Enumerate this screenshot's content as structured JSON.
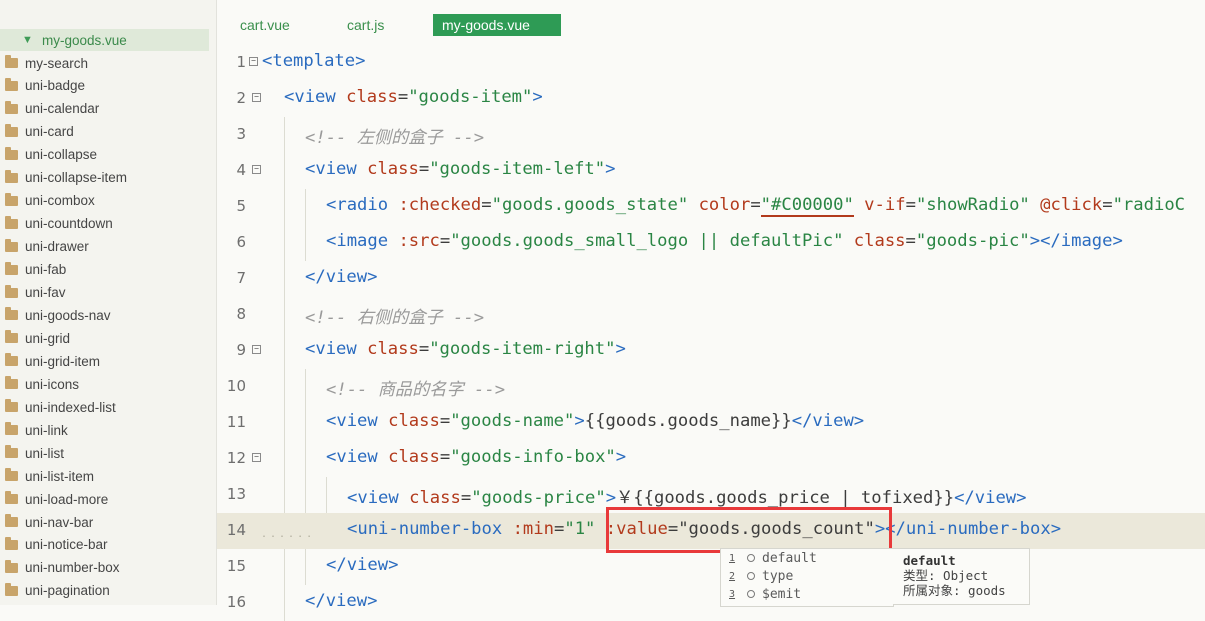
{
  "sidebar": {
    "root": "my-goods.vue",
    "items": [
      "my-search",
      "uni-badge",
      "uni-calendar",
      "uni-card",
      "uni-collapse",
      "uni-collapse-item",
      "uni-combox",
      "uni-countdown",
      "uni-drawer",
      "uni-fab",
      "uni-fav",
      "uni-goods-nav",
      "uni-grid",
      "uni-grid-item",
      "uni-icons",
      "uni-indexed-list",
      "uni-link",
      "uni-list",
      "uni-list-item",
      "uni-load-more",
      "uni-nav-bar",
      "uni-notice-bar",
      "uni-number-box",
      "uni-pagination"
    ]
  },
  "tabs": [
    "cart.vue",
    "cart.js",
    "my-goods.vue"
  ],
  "active_tab": 2,
  "editor": {
    "line_numbers": [
      "1",
      "2",
      "3",
      "4",
      "5",
      "6",
      "7",
      "8",
      "9",
      "10",
      "11",
      "12",
      "13",
      "14",
      "15",
      "16"
    ]
  },
  "code": {
    "l1": {
      "a": "<template>"
    },
    "l2": {
      "a": "<view ",
      "b": "class",
      "c": "=",
      "d": "\"goods-item\"",
      "e": ">"
    },
    "l3": {
      "a": "<!-- 左侧的盒子 -->"
    },
    "l4": {
      "a": "<view ",
      "b": "class",
      "c": "=",
      "d": "\"goods-item-left\"",
      "e": ">"
    },
    "l5": {
      "a": "<radio ",
      "b": ":checked",
      "c": "=",
      "d": "\"goods.goods_state\"",
      "e": " ",
      "f": "color",
      "g": "=",
      "h": "\"#C00000\"",
      "i": " ",
      "j": "v-if",
      "k": "=",
      "l": "\"showRadio\"",
      "m": " ",
      "n": "@click",
      "o": "=",
      "p": "\"radioC"
    },
    "l6": {
      "a": "<image ",
      "b": ":src",
      "c": "=",
      "d": "\"goods.goods_small_logo || defaultPic\"",
      "e": " ",
      "f": "class",
      "g": "=",
      "h": "\"goods-pic\"",
      "i": "></image>"
    },
    "l7": {
      "a": "</view>"
    },
    "l8": {
      "a": "<!-- 右侧的盒子 -->"
    },
    "l9": {
      "a": "<view ",
      "b": "class",
      "c": "=",
      "d": "\"goods-item-right\"",
      "e": ">"
    },
    "l10": {
      "a": "<!-- 商品的名字 -->"
    },
    "l11": {
      "a": "<view ",
      "b": "class",
      "c": "=",
      "d": "\"goods-name\"",
      "e": ">",
      "f": "{{goods.goods_name}}",
      "g": "</view>"
    },
    "l12": {
      "a": "<view ",
      "b": "class",
      "c": "=",
      "d": "\"goods-info-box\"",
      "e": ">"
    },
    "l13": {
      "a": "<view ",
      "b": "class",
      "c": "=",
      "d": "\"goods-price\"",
      "e": ">",
      "f": "￥{{goods.goods_price | tofixed}}",
      "g": "</view>"
    },
    "l14": {
      "a": "<uni-number-box ",
      "b": ":min",
      "c": "=",
      "d": "\"1\"",
      "e": " ",
      "f": ":value",
      "g": "=",
      "h": "\"goods.goods_count\"",
      "i": "></uni-number-box>",
      "dots": "......"
    },
    "l15": {
      "a": "</view>"
    },
    "l16": {
      "a": "</view>"
    }
  },
  "autocomplete": {
    "items": [
      {
        "num": "1",
        "label": "default"
      },
      {
        "num": "2",
        "label": "type"
      },
      {
        "num": "3",
        "label": "$emit"
      }
    ],
    "detail": {
      "title": "default",
      "type_line": "类型: Object",
      "owner_line": "所属对象: goods"
    }
  },
  "colors": {
    "tag": "#2a6bbf",
    "attr": "#b23a1c",
    "string": "#2a8544",
    "comment": "#9a9a9a",
    "active_tab": "#2e9b55",
    "highlight_box": "#e8393a"
  },
  "icons": {
    "root_arrow": "chevron-down-icon",
    "folder": "folder-icon"
  }
}
